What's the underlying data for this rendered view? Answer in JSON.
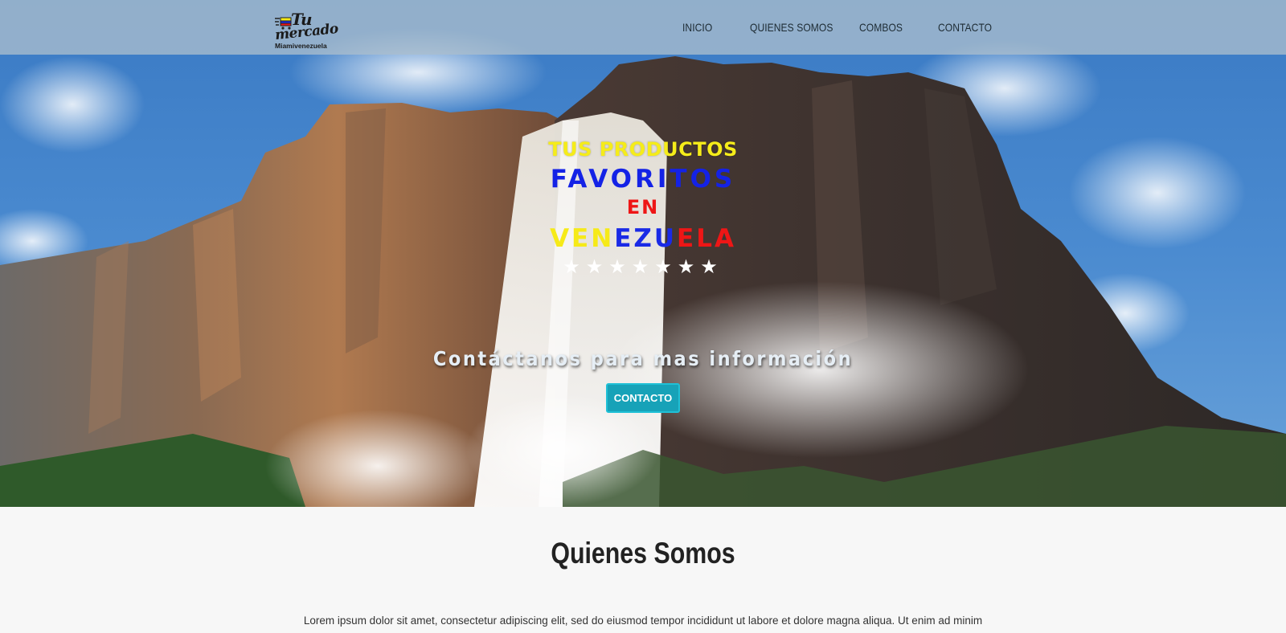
{
  "logo": {
    "title_top": "Tu",
    "title_bottom": "mercado",
    "subtitle": "Miamivenezuela"
  },
  "nav": {
    "items": [
      {
        "label": "INICIO"
      },
      {
        "label": "QUIENES SOMOS"
      },
      {
        "label": "COMBOS"
      },
      {
        "label": "CONTACTO"
      }
    ]
  },
  "hero": {
    "line1": "TUS PRODUCTOS",
    "line2": "FAVORITOS",
    "line3": "EN",
    "line4_parts": [
      "VEN",
      "EZU",
      "ELA"
    ],
    "stars": "★★★★★★★",
    "subtitle": "Contáctanos para mas información",
    "cta_label": "CONTACTO"
  },
  "about": {
    "title": "Quienes Somos",
    "text": "Lorem ipsum dolor sit amet, consectetur adipiscing elit, sed do eiusmod tempor incididunt ut labore et dolore magna aliqua. Ut enim ad minim"
  },
  "colors": {
    "flag_yellow": "#f6ea18",
    "flag_blue": "#1a2ae6",
    "flag_red": "#ee1616",
    "cta": "#17a2b8",
    "navbar": "#aabecd"
  }
}
